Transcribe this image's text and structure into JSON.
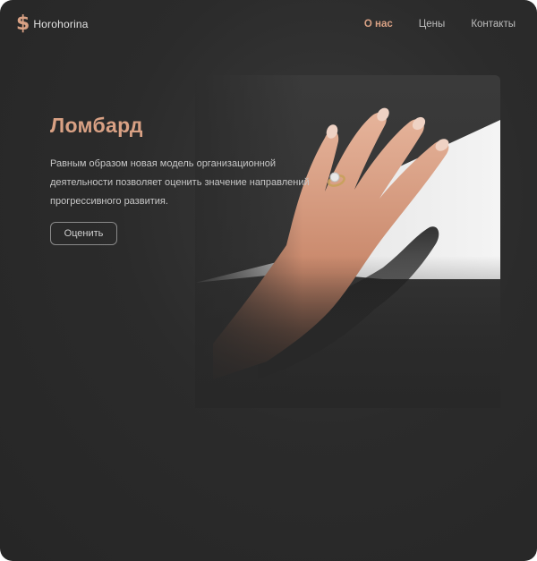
{
  "header": {
    "logo_icon": "$",
    "logo_text": "Horohorina",
    "nav": [
      {
        "label": "О нас",
        "active": true
      },
      {
        "label": "Цены",
        "active": false
      },
      {
        "label": "Контакты",
        "active": false
      }
    ]
  },
  "hero": {
    "title": "Ломбард",
    "description": "Равным образом новая модель организационной деятельности позволяет оценить значение направлений прогрессивного развития.",
    "button_label": "Оценить"
  },
  "colors": {
    "accent": "#d9a184",
    "background": "#2b2b2b",
    "text": "#c7c7c7"
  }
}
